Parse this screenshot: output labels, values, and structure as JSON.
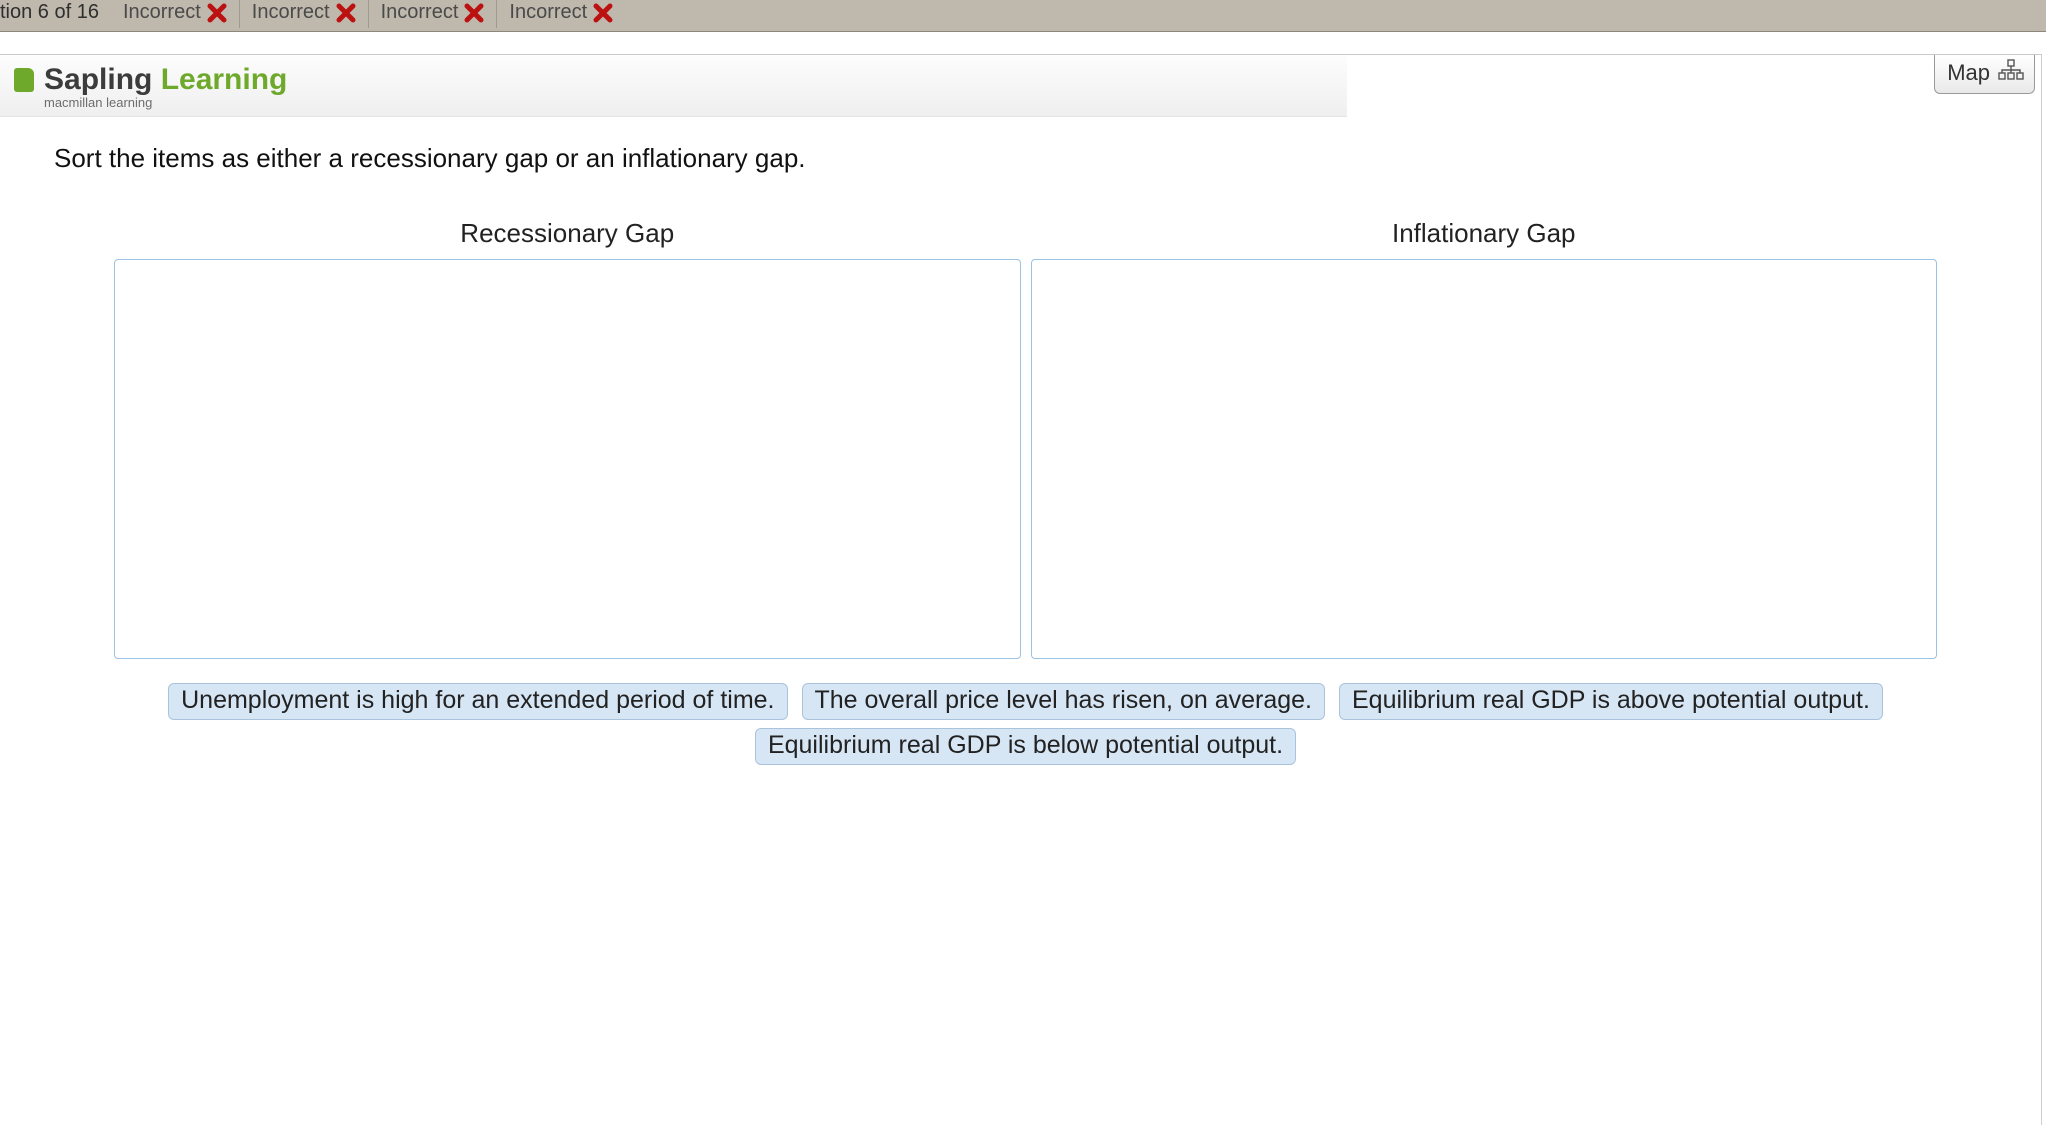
{
  "topbar": {
    "counter": "tion 6 of 16",
    "tabs": [
      {
        "label": "Incorrect"
      },
      {
        "label": "Incorrect"
      },
      {
        "label": "Incorrect"
      },
      {
        "label": "Incorrect"
      }
    ]
  },
  "brand": {
    "name1": "Sapling",
    "name2": "Learning",
    "sub": "macmillan learning"
  },
  "map_button": {
    "label": "Map"
  },
  "prompt": "Sort the items as either a recessionary gap or an inflationary gap.",
  "bins": [
    {
      "title": "Recessionary Gap"
    },
    {
      "title": "Inflationary Gap"
    }
  ],
  "chips": [
    "Unemployment is high for an extended period of time.",
    "The overall price level has risen, on average.",
    "Equilibrium real GDP is above potential output.",
    "Equilibrium real GDP is below potential output."
  ]
}
